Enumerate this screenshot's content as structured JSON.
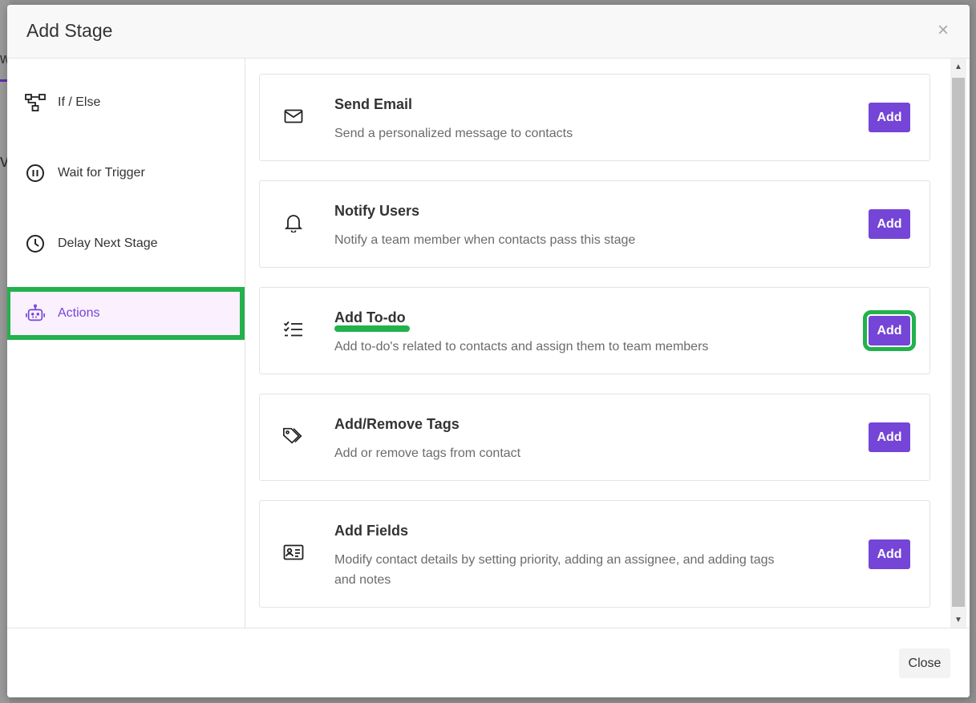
{
  "background": {
    "frag_a": "w",
    "frag_b": "v"
  },
  "modal": {
    "title": "Add Stage",
    "close_glyph": "×",
    "footer_close_label": "Close"
  },
  "sidebar": {
    "items": [
      {
        "label": "If / Else",
        "icon": "branch-icon",
        "active": false
      },
      {
        "label": "Wait for Trigger",
        "icon": "pause-circle-icon",
        "active": false
      },
      {
        "label": "Delay Next Stage",
        "icon": "clock-icon",
        "active": false
      },
      {
        "label": "Actions",
        "icon": "robot-icon",
        "active": true
      }
    ]
  },
  "actions": [
    {
      "title": "Send Email",
      "description": "Send a personalized message to contacts",
      "icon": "envelope-icon",
      "button": "Add"
    },
    {
      "title": "Notify Users",
      "description": "Notify a team member when contacts pass this stage",
      "icon": "bell-icon",
      "button": "Add"
    },
    {
      "title": "Add To-do",
      "description": "Add to-do's related to contacts and assign them to team members",
      "icon": "checklist-icon",
      "button": "Add",
      "highlighted": true
    },
    {
      "title": "Add/Remove Tags",
      "description": "Add or remove tags from contact",
      "icon": "tags-icon",
      "button": "Add"
    },
    {
      "title": "Add Fields",
      "description": "Modify contact details by setting priority, adding an assignee, and adding tags and notes",
      "icon": "id-card-icon",
      "button": "Add"
    }
  ],
  "colors": {
    "accent": "#7445d6",
    "active_bg": "#fbf0fe",
    "highlight": "#23b14d"
  }
}
